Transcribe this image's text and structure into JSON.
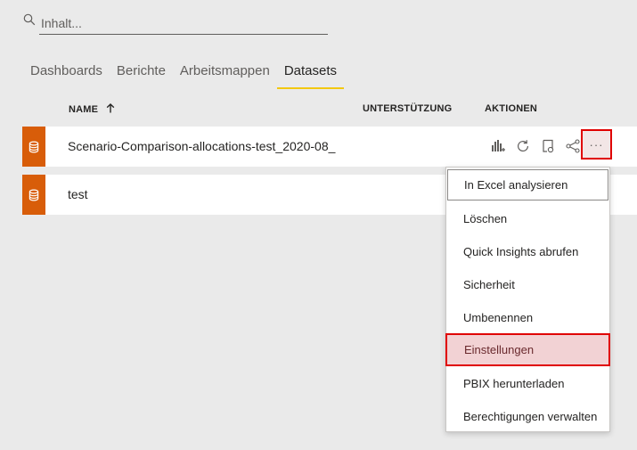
{
  "search": {
    "placeholder": "Inhalt..."
  },
  "tabs": [
    {
      "label": "Dashboards",
      "active": false
    },
    {
      "label": "Berichte",
      "active": false
    },
    {
      "label": "Arbeitsmappen",
      "active": false
    },
    {
      "label": "Datasets",
      "active": true
    }
  ],
  "columns": {
    "name": "NAME",
    "support": "UNTERSTÜTZUNG",
    "actions": "AKTIONEN"
  },
  "rows": [
    {
      "name": "Scenario-Comparison-allocations-test_2020-08_"
    },
    {
      "name": "test"
    }
  ],
  "row_actions": {
    "more_label": "···"
  },
  "menu": {
    "items": [
      {
        "label": "In Excel analysieren",
        "state": "focused"
      },
      {
        "label": "Löschen",
        "state": "normal"
      },
      {
        "label": "Quick Insights abrufen",
        "state": "normal"
      },
      {
        "label": "Sicherheit",
        "state": "normal"
      },
      {
        "label": "Umbenennen",
        "state": "normal"
      },
      {
        "label": "Einstellungen",
        "state": "highlighted"
      },
      {
        "label": "PBIX herunterladen",
        "state": "normal"
      },
      {
        "label": "Berechtigungen verwalten",
        "state": "normal"
      }
    ]
  },
  "colors": {
    "accent_tab": "#f2c811",
    "dataset_icon": "#d85d09",
    "highlight_border": "#e00000"
  }
}
